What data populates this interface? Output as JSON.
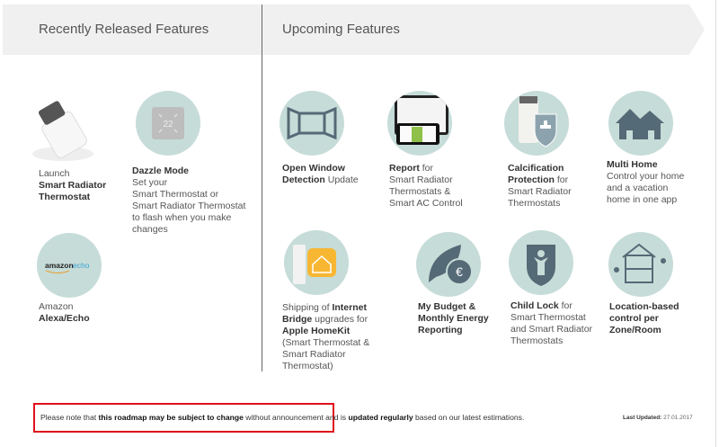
{
  "header": {
    "recent_title": "Recently Released Features",
    "upcoming_title": "Upcoming Features"
  },
  "colors": {
    "circle": "#c6dcd8",
    "icon": "#546a76",
    "band": "#f0f0f0",
    "highlight_box": "#e0101c"
  },
  "recent": [
    {
      "id": "smart-radiator-thermostat",
      "icon": "radiator-thermostat-photo",
      "lines": [
        [
          {
            "t": "Launch",
            "b": false
          }
        ],
        [
          {
            "t": "Smart Radiator",
            "b": true
          }
        ],
        [
          {
            "t": "Thermostat",
            "b": true
          }
        ]
      ]
    },
    {
      "id": "dazzle-mode",
      "icon": "thermostat-display-icon",
      "display_value": "22",
      "lines": [
        [
          {
            "t": "Dazzle Mode",
            "b": true
          }
        ],
        [
          {
            "t": "Set your",
            "b": false
          }
        ],
        [
          {
            "t": "Smart Thermostat or",
            "b": false
          }
        ],
        [
          {
            "t": "Smart Radiator Thermostat",
            "b": false
          }
        ],
        [
          {
            "t": "to flash when you make",
            "b": false
          }
        ],
        [
          {
            "t": "changes",
            "b": false
          }
        ]
      ]
    },
    {
      "id": "amazon-alexa-echo",
      "icon": "amazon-echo-logo",
      "logo_text": [
        "amazon",
        "echo"
      ],
      "lines": [
        [
          {
            "t": "Amazon",
            "b": false
          }
        ],
        [
          {
            "t": "Alexa/Echo",
            "b": true
          }
        ]
      ]
    }
  ],
  "upcoming": [
    {
      "id": "open-window-detection",
      "icon": "open-window-icon",
      "lines": [
        [
          {
            "t": "Open Window",
            "b": true
          }
        ],
        [
          {
            "t": "Detection",
            "b": true
          },
          {
            "t": " Update",
            "b": false
          }
        ]
      ]
    },
    {
      "id": "report",
      "icon": "tablet-phone-report-icon",
      "lines": [
        [
          {
            "t": "Report",
            "b": true
          },
          {
            "t": " for",
            "b": false
          }
        ],
        [
          {
            "t": "Smart Radiator",
            "b": false
          }
        ],
        [
          {
            "t": "Thermostats &",
            "b": false
          }
        ],
        [
          {
            "t": "Smart AC Control",
            "b": false
          }
        ]
      ]
    },
    {
      "id": "calcification-protection",
      "icon": "calcification-shield-icon",
      "lines": [
        [
          {
            "t": "Calcification",
            "b": true
          }
        ],
        [
          {
            "t": "Protection",
            "b": true
          },
          {
            "t": " for",
            "b": false
          }
        ],
        [
          {
            "t": "Smart Radiator",
            "b": false
          }
        ],
        [
          {
            "t": "Thermostats",
            "b": false
          }
        ]
      ]
    },
    {
      "id": "multi-home",
      "icon": "multi-home-icon",
      "lines": [
        [
          {
            "t": "Multi Home",
            "b": true
          }
        ],
        [
          {
            "t": "Control your home",
            "b": false
          }
        ],
        [
          {
            "t": "and a vacation",
            "b": false
          }
        ],
        [
          {
            "t": "home in one app",
            "b": false
          }
        ]
      ]
    },
    {
      "id": "internet-bridge-homekit",
      "icon": "homekit-bridge-icon",
      "lines": [
        [
          {
            "t": "Shipping of ",
            "b": false
          },
          {
            "t": "Internet",
            "b": true
          }
        ],
        [
          {
            "t": "Bridge",
            "b": true
          },
          {
            "t": " upgrades for",
            "b": false
          }
        ],
        [
          {
            "t": "Apple HomeKit",
            "b": true
          }
        ],
        [
          {
            "t": "(Smart Thermostat &",
            "b": false
          }
        ],
        [
          {
            "t": "Smart Radiator",
            "b": false
          }
        ],
        [
          {
            "t": "Thermostat)",
            "b": false
          }
        ]
      ]
    },
    {
      "id": "my-budget",
      "icon": "leaf-euro-icon",
      "lines": [
        [
          {
            "t": "My Budget &",
            "b": true
          }
        ],
        [
          {
            "t": "Monthly Energy",
            "b": true
          }
        ],
        [
          {
            "t": "Reporting",
            "b": true
          }
        ]
      ]
    },
    {
      "id": "child-lock",
      "icon": "child-lock-shield-icon",
      "lines": [
        [
          {
            "t": "Child Lock",
            "b": true
          },
          {
            "t": " for",
            "b": false
          }
        ],
        [
          {
            "t": "Smart Thermostat",
            "b": false
          }
        ],
        [
          {
            "t": "and Smart Radiator",
            "b": false
          }
        ],
        [
          {
            "t": "Thermostats",
            "b": false
          }
        ]
      ]
    },
    {
      "id": "location-based-control",
      "icon": "house-zones-location-icon",
      "lines": [
        [
          {
            "t": "Location-based",
            "b": true
          }
        ],
        [
          {
            "t": "control per",
            "b": true
          }
        ],
        [
          {
            "t": "Zone/Room",
            "b": true
          }
        ]
      ]
    }
  ],
  "footer": {
    "note_parts": [
      {
        "t": "Please note that ",
        "b": false
      },
      {
        "t": "this roadmap may be subject to change",
        "b": true
      },
      {
        "t": " without announcement and is ",
        "b": false
      },
      {
        "t": "updated regularly",
        "b": true
      },
      {
        "t": " based on our latest estimations.",
        "b": false
      }
    ],
    "last_updated_label": "Last Updated:",
    "last_updated_value": " 27.01.2017"
  }
}
